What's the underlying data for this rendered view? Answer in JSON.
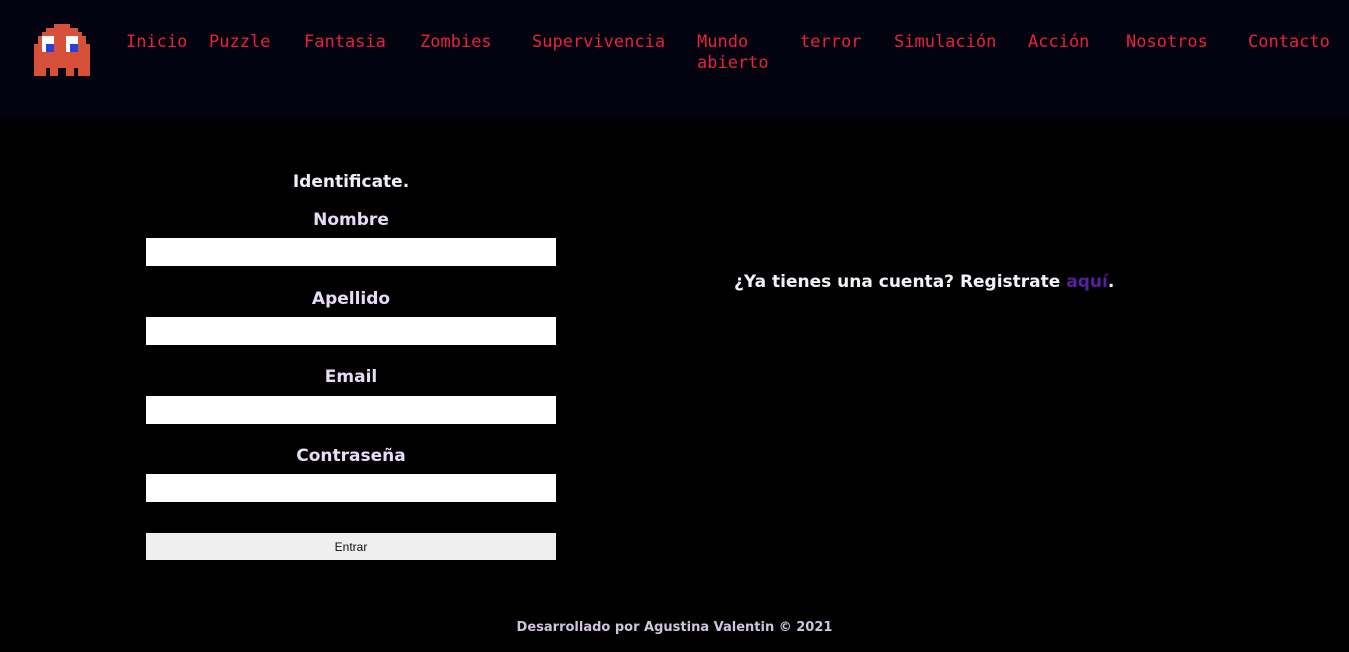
{
  "header": {
    "logo_icon": "pacman-ghost-icon",
    "logo_color": "#d6503a",
    "nav": [
      {
        "label": "Inicio"
      },
      {
        "label": "Puzzle"
      },
      {
        "label": "Fantasia"
      },
      {
        "label": "Zombies"
      },
      {
        "label": "Supervivencia"
      },
      {
        "label": "Mundo abierto"
      },
      {
        "label": "terror"
      },
      {
        "label": "Simulación"
      },
      {
        "label": "Acción"
      },
      {
        "label": "Nosotros"
      },
      {
        "label": "Contacto"
      }
    ],
    "nav_color": "#e8213f"
  },
  "form": {
    "title": "Identificate.",
    "fields": [
      {
        "label": "Nombre",
        "value": "",
        "placeholder": ""
      },
      {
        "label": "Apellido",
        "value": "",
        "placeholder": ""
      },
      {
        "label": "Email",
        "value": "",
        "placeholder": ""
      },
      {
        "label": "Contraseña",
        "value": "",
        "placeholder": ""
      }
    ],
    "submit_label": "Entrar"
  },
  "aside": {
    "text": "¿Ya tienes una cuenta? Registrate ",
    "link_label": "aquí",
    "suffix": "."
  },
  "footer": {
    "text": "Desarrollado por Agustina Valentin © 2021"
  }
}
